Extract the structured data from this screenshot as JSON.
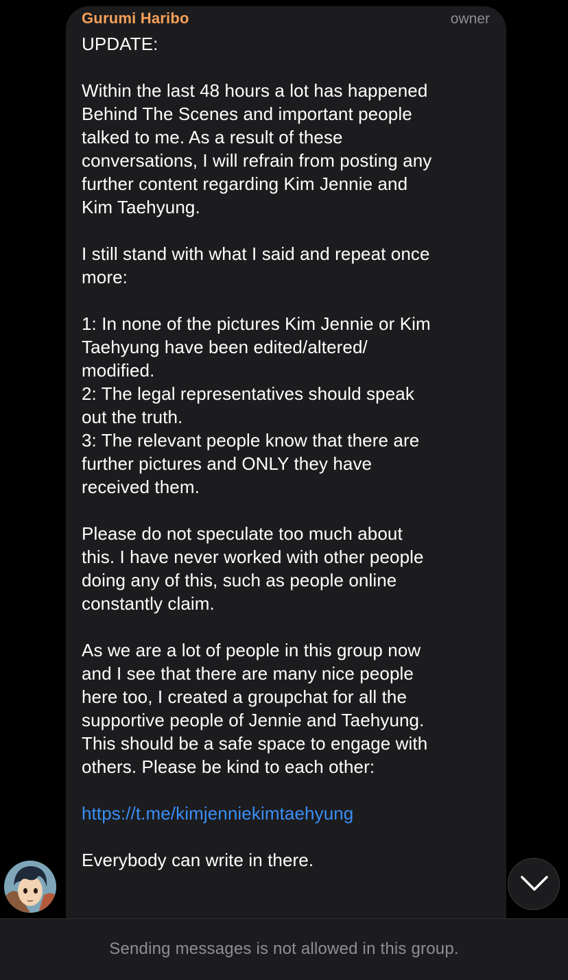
{
  "message": {
    "sender": "Gurumi Haribo",
    "role": "owner",
    "lines": [
      "UPDATE:",
      "",
      "Within the last 48 hours a lot has happened",
      "Behind The Scenes and important people",
      "talked to me. As a result of these",
      "conversations, I will refrain from posting any",
      "further content regarding Kim Jennie and",
      "Kim Taehyung.",
      "",
      "I still stand with what I said and repeat once",
      "more:",
      "",
      "1: In none of the pictures Kim Jennie or Kim",
      "Taehyung have been edited/altered/",
      "modified.",
      "2: The legal representatives should speak",
      "out the truth.",
      "3: The relevant people know that there are",
      "further pictures and ONLY they have",
      "received them.",
      "",
      "Please do not speculate too much about",
      "this. I have never worked with other people",
      "doing any of this, such as people online",
      "constantly claim.",
      "",
      "As we are a lot of people in this group now",
      "and I see that there are many nice people",
      "here too, I created a groupchat for all the",
      "supportive people of Jennie and Taehyung.",
      "This should be a safe space to engage with",
      "others. Please be kind to each other:",
      ""
    ],
    "link": "https://t.me/kimjenniekimtaehyung",
    "after_link": [
      "",
      "Everybody can write in there."
    ]
  },
  "footer": {
    "notice": "Sending messages is not allowed in this group."
  },
  "icons": {
    "avatar": "avatar",
    "scroll_down": "chevron-down-icon"
  },
  "colors": {
    "sender_name": "#f5a05a",
    "link": "#3a8ef6",
    "bubble": "#1c1c1e"
  }
}
